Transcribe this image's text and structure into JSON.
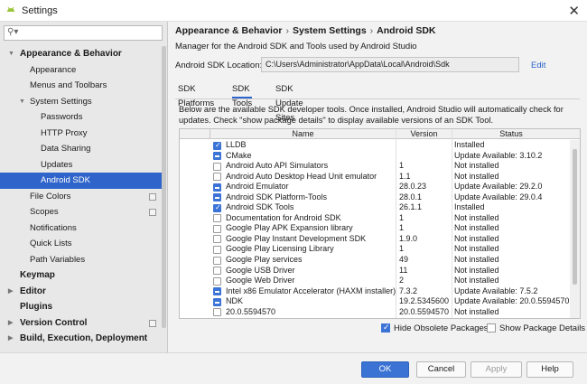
{
  "window": {
    "title": "Settings",
    "close_icon": "close-icon"
  },
  "search": {
    "value": "",
    "placeholder": ""
  },
  "sidebar": {
    "items": [
      {
        "label": "Appearance & Behavior",
        "level": 0,
        "bold": true,
        "arrow": "▼"
      },
      {
        "label": "Appearance",
        "level": 1
      },
      {
        "label": "Menus and Toolbars",
        "level": 1
      },
      {
        "label": "System Settings",
        "level": 1,
        "arrow": "▼"
      },
      {
        "label": "Passwords",
        "level": 2
      },
      {
        "label": "HTTP Proxy",
        "level": 2
      },
      {
        "label": "Data Sharing",
        "level": 2
      },
      {
        "label": "Updates",
        "level": 2
      },
      {
        "label": "Android SDK",
        "level": 2,
        "selected": true
      },
      {
        "label": "File Colors",
        "level": 1,
        "project_icon": true
      },
      {
        "label": "Scopes",
        "level": 1,
        "project_icon": true
      },
      {
        "label": "Notifications",
        "level": 1
      },
      {
        "label": "Quick Lists",
        "level": 1
      },
      {
        "label": "Path Variables",
        "level": 1
      },
      {
        "label": "Keymap",
        "level": 0,
        "bold": true
      },
      {
        "label": "Editor",
        "level": 0,
        "bold": true,
        "arrow": "▶"
      },
      {
        "label": "Plugins",
        "level": 0,
        "bold": true
      },
      {
        "label": "Version Control",
        "level": 0,
        "bold": true,
        "arrow": "▶",
        "project_icon": true
      },
      {
        "label": "Build, Execution, Deployment",
        "level": 0,
        "bold": true,
        "arrow": "▶"
      }
    ]
  },
  "breadcrumb": [
    "Appearance & Behavior",
    "System Settings",
    "Android SDK"
  ],
  "subtitle": "Manager for the Android SDK and Tools used by Android Studio",
  "sdk_location": {
    "label": "Android SDK Location:",
    "value": "C:\\Users\\Administrator\\AppData\\Local\\Android\\Sdk",
    "edit_label": "Edit"
  },
  "tabs": [
    {
      "label": "SDK Platforms",
      "active": false
    },
    {
      "label": "SDK Tools",
      "active": true
    },
    {
      "label": "SDK Update Sites",
      "active": false
    }
  ],
  "description": "Below are the available SDK developer tools. Once installed, Android Studio will automatically check for updates. Check \"show package details\" to display available versions of an SDK Tool.",
  "table": {
    "columns": [
      "Name",
      "Version",
      "Status"
    ],
    "rows": [
      {
        "state": "checked",
        "name": "LLDB",
        "version": "",
        "status": "Installed"
      },
      {
        "state": "partial",
        "name": "CMake",
        "version": "",
        "status": "Update Available: 3.10.2"
      },
      {
        "state": "unchecked",
        "name": "Android Auto API Simulators",
        "version": "1",
        "status": "Not installed"
      },
      {
        "state": "unchecked",
        "name": "Android Auto Desktop Head Unit emulator",
        "version": "1.1",
        "status": "Not installed"
      },
      {
        "state": "partial",
        "name": "Android Emulator",
        "version": "28.0.23",
        "status": "Update Available: 29.2.0"
      },
      {
        "state": "partial",
        "name": "Android SDK Platform-Tools",
        "version": "28.0.1",
        "status": "Update Available: 29.0.4"
      },
      {
        "state": "checked",
        "name": "Android SDK Tools",
        "version": "26.1.1",
        "status": "Installed"
      },
      {
        "state": "unchecked",
        "name": "Documentation for Android SDK",
        "version": "1",
        "status": "Not installed"
      },
      {
        "state": "unchecked",
        "name": "Google Play APK Expansion library",
        "version": "1",
        "status": "Not installed"
      },
      {
        "state": "unchecked",
        "name": "Google Play Instant Development SDK",
        "version": "1.9.0",
        "status": "Not installed"
      },
      {
        "state": "unchecked",
        "name": "Google Play Licensing Library",
        "version": "1",
        "status": "Not installed"
      },
      {
        "state": "unchecked",
        "name": "Google Play services",
        "version": "49",
        "status": "Not installed"
      },
      {
        "state": "unchecked",
        "name": "Google USB Driver",
        "version": "11",
        "status": "Not installed"
      },
      {
        "state": "unchecked",
        "name": "Google Web Driver",
        "version": "2",
        "status": "Not installed"
      },
      {
        "state": "partial",
        "name": "Intel x86 Emulator Accelerator (HAXM installer)",
        "version": "7.3.2",
        "status": "Update Available: 7.5.2"
      },
      {
        "state": "partial",
        "name": "NDK",
        "version": "19.2.5345600",
        "status": "Update Available: 20.0.5594570"
      },
      {
        "state": "unchecked",
        "name": "20.0.5594570",
        "version": "20.0.5594570",
        "status": "Not installed"
      }
    ]
  },
  "options": {
    "hide_obsolete": {
      "label": "Hide Obsolete Packages",
      "checked": true
    },
    "show_details": {
      "label": "Show Package Details",
      "checked": false
    }
  },
  "buttons": {
    "ok": "OK",
    "cancel": "Cancel",
    "apply": "Apply",
    "help": "Help"
  },
  "colors": {
    "accent": "#3a73d4",
    "selected": "#2f65ca",
    "link": "#2a62c7"
  }
}
